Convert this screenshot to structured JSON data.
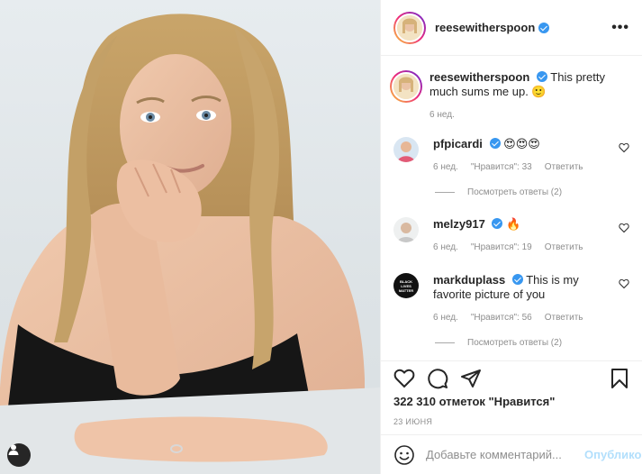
{
  "header": {
    "username": "reesewitherspoon",
    "more_label": "•••"
  },
  "caption": {
    "username": "reesewitherspoon",
    "text": "This pretty much sums me up. 🙂",
    "time": "6 нед."
  },
  "comments": [
    {
      "username": "pfpicardi",
      "text": "😍😍😍",
      "time": "6 нед.",
      "likes": "\"Нравится\": 33",
      "reply": "Ответить",
      "view_replies": "Посмотреть ответы (2)"
    },
    {
      "username": "melzy917",
      "text": "🔥",
      "time": "6 нед.",
      "likes": "\"Нравится\": 19",
      "reply": "Ответить"
    },
    {
      "username": "markduplass",
      "text": "This is my favorite picture of you",
      "time": "6 нед.",
      "likes": "\"Нравится\": 56",
      "reply": "Ответить",
      "view_replies": "Посмотреть ответы (2)",
      "avatar_text": "BLACK LIVES MATTER"
    }
  ],
  "post": {
    "likes": "322 310 отметок \"Нравится\"",
    "date": "23 ИЮНЯ"
  },
  "add_comment": {
    "placeholder": "Добавьте комментарий...",
    "publish_label": "Опубликовать"
  },
  "icons": {
    "like": "heart-icon",
    "comment": "comment-icon",
    "share": "paper-plane-icon",
    "save": "bookmark-icon",
    "emoji": "smiley-icon",
    "user_tag": "person-icon",
    "verified": "verified-badge-icon"
  },
  "colors": {
    "verified": "#3897f0",
    "publish_disabled": "#b2dffc",
    "muted_text": "#8e8e8e"
  }
}
